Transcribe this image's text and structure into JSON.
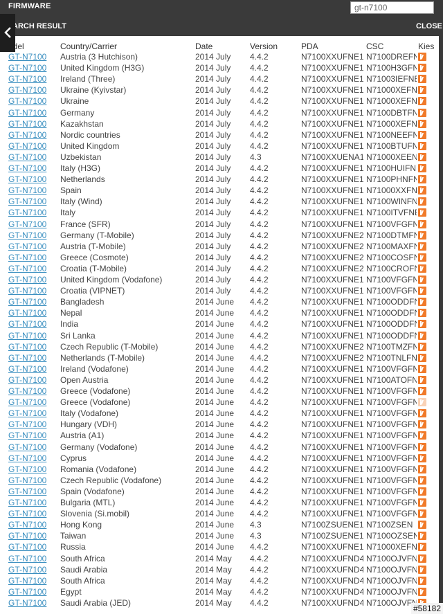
{
  "window": {
    "brand": "FIRMWARE",
    "panel_title": "ARCH RESULT",
    "close_label": "CLOSE"
  },
  "search": {
    "value": "gt-n7100"
  },
  "table": {
    "headers": {
      "model": "odel",
      "country": "Country/Carrier",
      "date": "Date",
      "version": "Version",
      "pda": "PDA",
      "csc": "CSC",
      "kies": "Kies"
    },
    "rows": [
      {
        "model": "GT-N7100",
        "country": "Austria (3 Hutchison)",
        "date": "2014 July",
        "version": "4.4.2",
        "pda": "N7100XXUFNE1",
        "csc": "N7100DREFN"
      },
      {
        "model": "GT-N7100",
        "country": "United Kingdom (H3G)",
        "date": "2014 July",
        "version": "4.4.2",
        "pda": "N7100XXUFNE1",
        "csc": "N7100H3GFN"
      },
      {
        "model": "GT-N7100",
        "country": "Ireland (Three)",
        "date": "2014 July",
        "version": "4.4.2",
        "pda": "N7100XXUFNE1",
        "csc": "N71003IEFNE"
      },
      {
        "model": "GT-N7100",
        "country": "Ukraine (Kyivstar)",
        "date": "2014 July",
        "version": "4.4.2",
        "pda": "N7100XXUFNE1",
        "csc": "N71000XEFN"
      },
      {
        "model": "GT-N7100",
        "country": "Ukraine",
        "date": "2014 July",
        "version": "4.4.2",
        "pda": "N7100XXUFNE1",
        "csc": "N71000XEFN"
      },
      {
        "model": "GT-N7100",
        "country": "Germany",
        "date": "2014 July",
        "version": "4.4.2",
        "pda": "N7100XXUFNE1",
        "csc": "N7100DBTFN"
      },
      {
        "model": "GT-N7100",
        "country": "Kazakhstan",
        "date": "2014 July",
        "version": "4.4.2",
        "pda": "N7100XXUFNE1",
        "csc": "N71000XEFN"
      },
      {
        "model": "GT-N7100",
        "country": "Nordic countries",
        "date": "2014 July",
        "version": "4.4.2",
        "pda": "N7100XXUFNE1",
        "csc": "N7100NEEFN"
      },
      {
        "model": "GT-N7100",
        "country": "United Kingdom",
        "date": "2014 July",
        "version": "4.4.2",
        "pda": "N7100XXUFNE1",
        "csc": "N7100BTUFN"
      },
      {
        "model": "GT-N7100",
        "country": "Uzbekistan",
        "date": "2014 July",
        "version": "4.3",
        "pda": "N7100XXUENA1",
        "csc": "N71000XEEN"
      },
      {
        "model": "GT-N7100",
        "country": "Italy (H3G)",
        "date": "2014 July",
        "version": "4.4.2",
        "pda": "N7100XXUFNE1",
        "csc": "N7100HUIFNE"
      },
      {
        "model": "GT-N7100",
        "country": "Netherlands",
        "date": "2014 July",
        "version": "4.4.2",
        "pda": "N7100XXUFNE1",
        "csc": "N7100PHNFN"
      },
      {
        "model": "GT-N7100",
        "country": "Spain",
        "date": "2014 July",
        "version": "4.4.2",
        "pda": "N7100XXUFNE1",
        "csc": "N71000XXFN"
      },
      {
        "model": "GT-N7100",
        "country": "Italy (Wind)",
        "date": "2014 July",
        "version": "4.4.2",
        "pda": "N7100XXUFNE1",
        "csc": "N7100WINFN"
      },
      {
        "model": "GT-N7100",
        "country": "Italy",
        "date": "2014 July",
        "version": "4.4.2",
        "pda": "N7100XXUFNE1",
        "csc": "N7100ITVFNE"
      },
      {
        "model": "GT-N7100",
        "country": "France (SFR)",
        "date": "2014 July",
        "version": "4.4.2",
        "pda": "N7100XXUFNE1",
        "csc": "N7100VFGFN"
      },
      {
        "model": "GT-N7100",
        "country": "Germany (T-Mobile)",
        "date": "2014 July",
        "version": "4.4.2",
        "pda": "N7100XXUFNE2",
        "csc": "N7100DTMFN"
      },
      {
        "model": "GT-N7100",
        "country": "Austria (T-Mobile)",
        "date": "2014 July",
        "version": "4.4.2",
        "pda": "N7100XXUFNE2",
        "csc": "N7100MAXFN"
      },
      {
        "model": "GT-N7100",
        "country": "Greece (Cosmote)",
        "date": "2014 July",
        "version": "4.4.2",
        "pda": "N7100XXUFNE2",
        "csc": "N7100COSFN"
      },
      {
        "model": "GT-N7100",
        "country": "Croatia (T-Mobile)",
        "date": "2014 July",
        "version": "4.4.2",
        "pda": "N7100XXUFNE2",
        "csc": "N7100CROFN"
      },
      {
        "model": "GT-N7100",
        "country": "United Kingdom (Vodafone)",
        "date": "2014 July",
        "version": "4.4.2",
        "pda": "N7100XXUFNE1",
        "csc": "N7100VFGFN"
      },
      {
        "model": "GT-N7100",
        "country": "Croatia (VIPNET)",
        "date": "2014 July",
        "version": "4.4.2",
        "pda": "N7100XXUFNE1",
        "csc": "N7100VFGFN"
      },
      {
        "model": "GT-N7100",
        "country": "Bangladesh",
        "date": "2014 June",
        "version": "4.4.2",
        "pda": "N7100XXUFNE1",
        "csc": "N7100ODDFN"
      },
      {
        "model": "GT-N7100",
        "country": "Nepal",
        "date": "2014 June",
        "version": "4.4.2",
        "pda": "N7100XXUFNE1",
        "csc": "N7100ODDFN"
      },
      {
        "model": "GT-N7100",
        "country": "India",
        "date": "2014 June",
        "version": "4.4.2",
        "pda": "N7100XXUFNE1",
        "csc": "N7100ODDFN"
      },
      {
        "model": "GT-N7100",
        "country": "Sri Lanka",
        "date": "2014 June",
        "version": "4.4.2",
        "pda": "N7100XXUFNE1",
        "csc": "N7100ODDFN"
      },
      {
        "model": "GT-N7100",
        "country": "Czech Republic (T-Mobile)",
        "date": "2014 June",
        "version": "4.4.2",
        "pda": "N7100XXUFNE2",
        "csc": "N7100TMZFN"
      },
      {
        "model": "GT-N7100",
        "country": "Netherlands (T-Mobile)",
        "date": "2014 June",
        "version": "4.4.2",
        "pda": "N7100XXUFNE2",
        "csc": "N7100TNLFN"
      },
      {
        "model": "GT-N7100",
        "country": "Ireland (Vodafone)",
        "date": "2014 June",
        "version": "4.4.2",
        "pda": "N7100XXUFNE1",
        "csc": "N7100VFGFN"
      },
      {
        "model": "GT-N7100",
        "country": "Open Austria",
        "date": "2014 June",
        "version": "4.4.2",
        "pda": "N7100XXUFNE1",
        "csc": "N7100ATOFN"
      },
      {
        "model": "GT-N7100",
        "country": "Greece (Vodafone)",
        "date": "2014 June",
        "version": "4.4.2",
        "pda": "N7100XXUFNE1",
        "csc": "N7100VFGFN"
      },
      {
        "model": "GT-N7100",
        "country": "Greece (Vodafone)",
        "date": "2014 June",
        "version": "4.4.2",
        "pda": "N7100XXUFNE1",
        "csc": "N7100VFGFN",
        "faded": true
      },
      {
        "model": "GT-N7100",
        "country": "Italy (Vodafone)",
        "date": "2014 June",
        "version": "4.4.2",
        "pda": "N7100XXUFNE1",
        "csc": "N7100VFGFN"
      },
      {
        "model": "GT-N7100",
        "country": "Hungary (VDH)",
        "date": "2014 June",
        "version": "4.4.2",
        "pda": "N7100XXUFNE1",
        "csc": "N7100VFGFN"
      },
      {
        "model": "GT-N7100",
        "country": "Austria (A1)",
        "date": "2014 June",
        "version": "4.4.2",
        "pda": "N7100XXUFNE1",
        "csc": "N7100VFGFN"
      },
      {
        "model": "GT-N7100",
        "country": "Germany (Vodafone)",
        "date": "2014 June",
        "version": "4.4.2",
        "pda": "N7100XXUFNE1",
        "csc": "N7100VFGFN"
      },
      {
        "model": "GT-N7100",
        "country": "Cyprus",
        "date": "2014 June",
        "version": "4.4.2",
        "pda": "N7100XXUFNE1",
        "csc": "N7100VFGFN"
      },
      {
        "model": "GT-N7100",
        "country": "Romania (Vodafone)",
        "date": "2014 June",
        "version": "4.4.2",
        "pda": "N7100XXUFNE1",
        "csc": "N7100VFGFN"
      },
      {
        "model": "GT-N7100",
        "country": "Czech Republic (Vodafone)",
        "date": "2014 June",
        "version": "4.4.2",
        "pda": "N7100XXUFNE1",
        "csc": "N7100VFGFN"
      },
      {
        "model": "GT-N7100",
        "country": "Spain (Vodafone)",
        "date": "2014 June",
        "version": "4.4.2",
        "pda": "N7100XXUFNE1",
        "csc": "N7100VFGFN"
      },
      {
        "model": "GT-N7100",
        "country": "Bulgaria (MTL)",
        "date": "2014 June",
        "version": "4.4.2",
        "pda": "N7100XXUFNE1",
        "csc": "N7100VFGFN"
      },
      {
        "model": "GT-N7100",
        "country": "Slovenia (Si.mobil)",
        "date": "2014 June",
        "version": "4.4.2",
        "pda": "N7100XXUFNE1",
        "csc": "N7100VFGFN"
      },
      {
        "model": "GT-N7100",
        "country": "Hong Kong",
        "date": "2014 June",
        "version": "4.3",
        "pda": "N7100ZSUENE1",
        "csc": "N7100ZSEN"
      },
      {
        "model": "GT-N7100",
        "country": "Taiwan",
        "date": "2014 June",
        "version": "4.3",
        "pda": "N7100ZSUENE1",
        "csc": "N7100OZSEN"
      },
      {
        "model": "GT-N7100",
        "country": "Russia",
        "date": "2014 June",
        "version": "4.4.2",
        "pda": "N7100XXUFNE1",
        "csc": "N71000XEFN"
      },
      {
        "model": "GT-N7100",
        "country": "South Africa",
        "date": "2014 May",
        "version": "4.4.2",
        "pda": "N7100XXUFND4",
        "csc": "N7100OJVFN"
      },
      {
        "model": "GT-N7100",
        "country": "Saudi Arabia",
        "date": "2014 May",
        "version": "4.4.2",
        "pda": "N7100XXUFND4",
        "csc": "N7100OJVFN"
      },
      {
        "model": "GT-N7100",
        "country": "South Africa",
        "date": "2014 May",
        "version": "4.4.2",
        "pda": "N7100XXUFND4",
        "csc": "N7100OJVFN"
      },
      {
        "model": "GT-N7100",
        "country": "Egypt",
        "date": "2014 May",
        "version": "4.4.2",
        "pda": "N7100XXUFND4",
        "csc": "N7100OJVFN"
      },
      {
        "model": "GT-N7100",
        "country": "Saudi Arabia (JED)",
        "date": "2014 May",
        "version": "4.4.2",
        "pda": "N7100XXUFND4",
        "csc": "N7100OJVFN"
      }
    ]
  },
  "watermark": "#58182",
  "colors": {
    "header_bg": "#3a3a3a",
    "link": "#3a8fc0",
    "kies_icon": "#f07a2a"
  }
}
